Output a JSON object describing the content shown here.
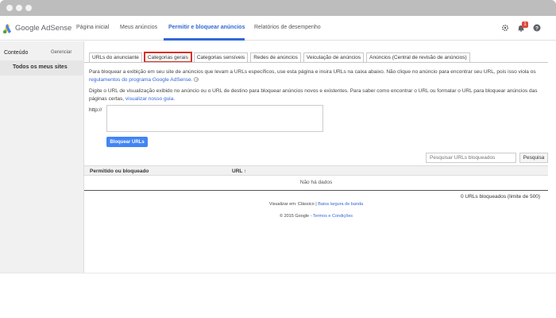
{
  "header": {
    "brand": "Google AdSense",
    "nav": [
      {
        "label": "Página inicial",
        "active": false
      },
      {
        "label": "Meus anúncios",
        "active": false
      },
      {
        "label": "Permitir e bloquear anúncios",
        "active": true
      },
      {
        "label": "Relatórios de desempenho",
        "active": false
      }
    ],
    "notification_count": "1",
    "icons": [
      "gear-icon",
      "bell-icon",
      "help-icon"
    ]
  },
  "sidebar": {
    "title": "Conteúdo",
    "manage_label": "Gerenciar",
    "items": [
      {
        "label": "Todos os meus sites",
        "selected": true
      }
    ]
  },
  "tabs": [
    {
      "label": "URLs do anunciante",
      "active": false
    },
    {
      "label": "Categorias gerais",
      "active": true
    },
    {
      "label": "Categorias sensíveis",
      "active": false
    },
    {
      "label": "Redes de anúncios",
      "active": false
    },
    {
      "label": "Veiculação de anúncios",
      "active": false
    },
    {
      "label": "Anúncios (Central de revisão de anúncios)",
      "active": false
    }
  ],
  "intro": {
    "text": "Para bloquear a exibição em seu site de anúncios que levam a URLs específicos, use esta página e insira URLs na caixa abaixo. Não clique no anúncio para encontrar seu URL, pois isso viola os",
    "link": "regulamentos do programa Google AdSense."
  },
  "instructions": {
    "text": "Digite o URL de visualização exibido no anúncio ou o URL de destino para bloquear anúncios novos e existentes. Para saber como encontrar o URL ou formatar o URL para bloquear anúncios das páginas certas,",
    "link": "visualizar nosso guia."
  },
  "form": {
    "prefix": "http://",
    "textarea_value": "",
    "block_button": "Bloquear URLs"
  },
  "search": {
    "placeholder": "Pesquisar URLs bloqueados",
    "button": "Pesquisa"
  },
  "table": {
    "col_status": "Permitido ou bloqueado",
    "col_url": "URL ↑",
    "empty": "Não há dados",
    "count": "0 URLs bloqueados (limite de 500)"
  },
  "footer": {
    "view_prefix": "Visualizar em:",
    "view_current": "Clássico",
    "separator": "|",
    "view_link": "Baixa largura de banda",
    "copyright": "© 2015 Google -",
    "terms_link": "Termos e Condições"
  },
  "colors": {
    "accent": "#3367d6",
    "button_blue": "#4285f4",
    "active_tab_border": "#d93025",
    "badge": "#dd4b39"
  }
}
